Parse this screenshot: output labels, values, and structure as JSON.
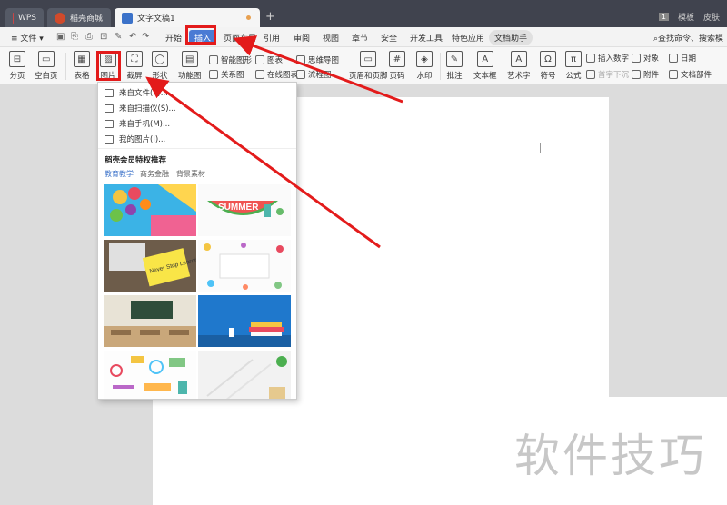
{
  "titlebar": {
    "tabs": [
      {
        "label": "WPS"
      },
      {
        "label": "稻壳商城"
      },
      {
        "label": "文字文稿1"
      }
    ],
    "new_tab": "+",
    "badge": "1",
    "template_label": "模板",
    "skin_label": "皮肤"
  },
  "menubar": {
    "file_label": "文件",
    "items": [
      "开始",
      "插入",
      "页面布局",
      "引用",
      "审阅",
      "视图",
      "章节",
      "安全",
      "开发工具",
      "特色应用",
      "文档助手"
    ],
    "search_placeholder": "查找命令、搜索模"
  },
  "ribbon": {
    "buttons": [
      "分页",
      "空白页",
      "表格",
      "图片",
      "截屏",
      "形状",
      "功能图",
      "页眉和页脚",
      "页码",
      "水印",
      "批注",
      "文本框",
      "艺术字",
      "符号",
      "公式"
    ],
    "small": {
      "smart_shape": "智能图形",
      "chart": "图表",
      "mind_map": "思维导图",
      "relation": "关系图",
      "online_chart": "在线图表",
      "flowchart": "流程图",
      "insert_number": "插入数字",
      "object": "对象",
      "date": "日期",
      "first_drop": "首字下沉",
      "attachment": "附件",
      "doc_parts": "文档部件"
    }
  },
  "dropdown": {
    "items": [
      "来自文件(P)...",
      "来自扫描仪(S)...",
      "来自手机(M)...",
      "我的图片(I)..."
    ],
    "section_title": "稻壳会员特权推荐",
    "tabs": [
      "教育教学",
      "商务金融",
      "背景素材"
    ],
    "summer_text": "SUMMER",
    "learning_text": "Never Stop Learning"
  },
  "watermark": "软件技巧",
  "colors": {
    "highlight": "#e31b1b",
    "accent": "#4a7bd4",
    "titlebar": "#40434e"
  }
}
